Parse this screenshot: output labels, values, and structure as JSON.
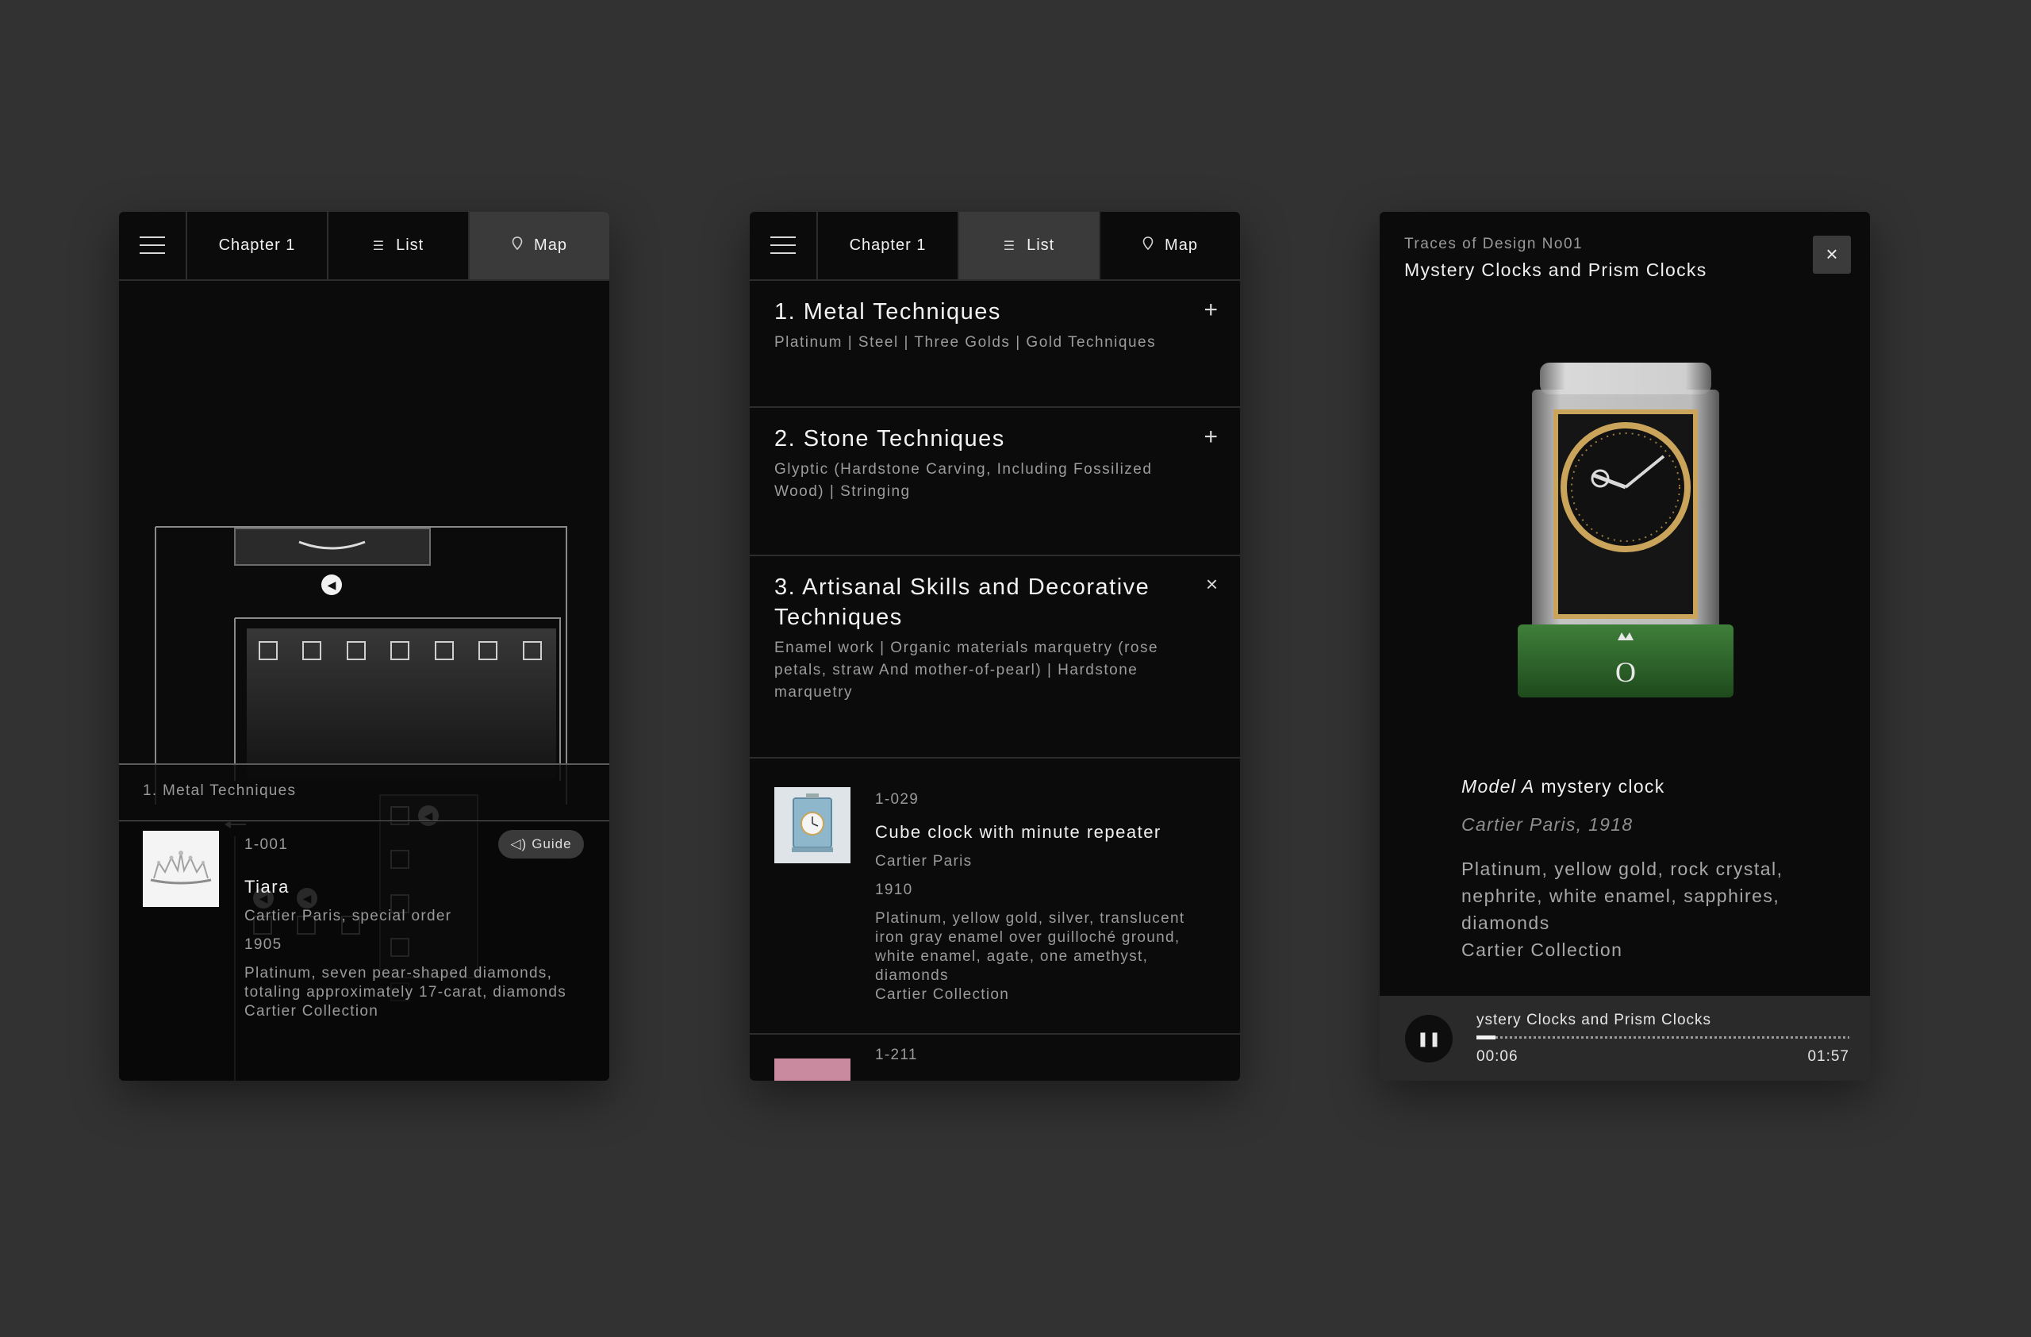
{
  "nav": {
    "chapter_label": "Chapter 1",
    "list_label": "List",
    "map_label": "Map"
  },
  "map_view": {
    "section_label": "1. Metal Techniques",
    "item": {
      "number": "1-001",
      "title": "Tiara",
      "maker": "Cartier Paris, special order",
      "year": "1905",
      "materials_1": "Platinum, seven pear-shaped diamonds,",
      "materials_2": "totaling approximately 17-carat, diamonds",
      "collection": "Cartier Collection",
      "guide_label": "Guide"
    }
  },
  "list_view": {
    "sections": [
      {
        "title": "1. Metal Techniques",
        "subtitle": "Platinum  |  Steel  |  Three Golds  |  Gold Techniques",
        "toggle": "+"
      },
      {
        "title": "2. Stone Techniques",
        "subtitle_1": "Glyptic (Hardstone Carving, Including Fossilized",
        "subtitle_2": "Wood)  |  Stringing",
        "toggle": "+"
      },
      {
        "title_1": "3. Artisanal Skills and Decorative",
        "title_2": "Techniques",
        "subtitle_1": "Enamel work  |  Organic materials marquetry (rose",
        "subtitle_2": "petals, straw And mother-of-pearl)  |  Hardstone",
        "subtitle_3": "marquetry",
        "toggle": "×"
      }
    ],
    "items": [
      {
        "number": "1-029",
        "title": "Cube clock with minute repeater",
        "maker": "Cartier Paris",
        "year": "1910",
        "materials_1": "Platinum, yellow gold, silver, translucent",
        "materials_2": "iron gray enamel over guilloché ground,",
        "materials_3": "white enamel, agate, one amethyst,",
        "materials_4": "diamonds",
        "collection": "Cartier Collection"
      },
      {
        "number": "1-211"
      }
    ]
  },
  "detail_view": {
    "series": "Traces of Design No01",
    "title": "Mystery Clocks and Prism Clocks",
    "close_icon": "×",
    "object_model": "Model A",
    "object_name": " mystery clock",
    "maker": "Cartier Paris, 1918",
    "materials_1": "Platinum, yellow gold, rock crystal,",
    "materials_2": "nephrite, white enamel, sapphires,",
    "materials_3": "diamonds",
    "collection": "Cartier Collection",
    "player": {
      "track": "ystery Clocks and Prism Clocks",
      "elapsed": "00:06",
      "duration": "01:57",
      "progress": 0.05
    }
  },
  "colors": {
    "background": "#323232",
    "panel": "#0b0b0b",
    "active_tab": "#3a3a3a",
    "nephrite_green": "#2f6a2c",
    "gold": "#c9a45a"
  }
}
